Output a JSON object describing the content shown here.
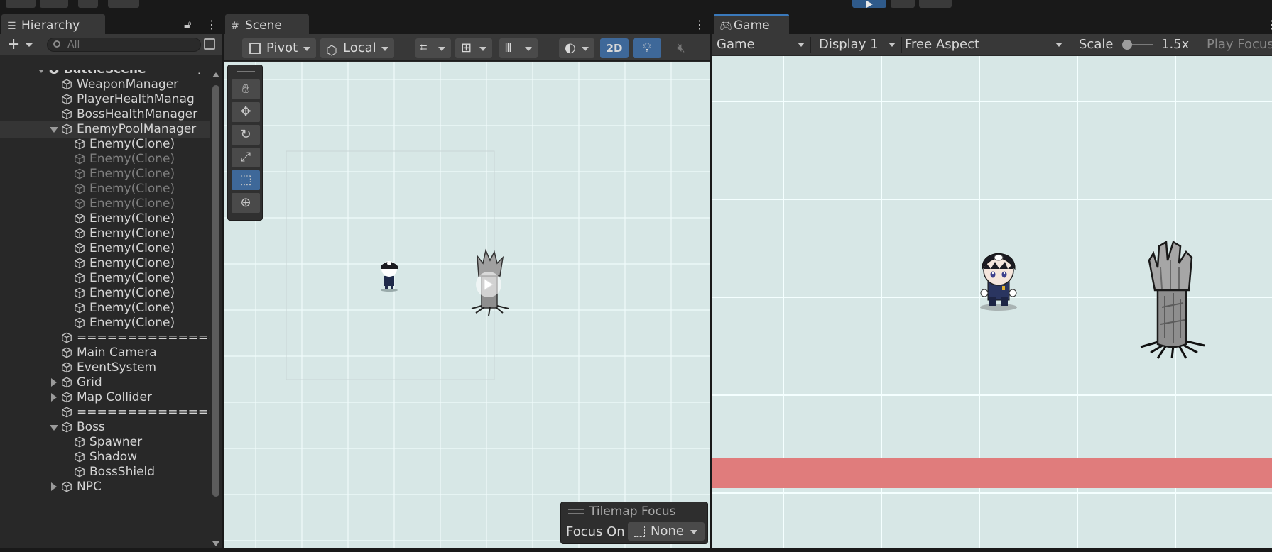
{
  "hierarchy": {
    "tab_label": "Hierarchy",
    "search_placeholder": "All",
    "rows": [
      {
        "label": "BattleScene",
        "indent": 0,
        "expander": "down",
        "icon": "unity-scene-icon",
        "bold": true,
        "dim": false
      },
      {
        "label": "WeaponManager",
        "indent": 1,
        "expander": "none",
        "icon": "gameobject-cube-icon",
        "bold": false,
        "dim": false
      },
      {
        "label": "PlayerHealthManag",
        "indent": 1,
        "expander": "none",
        "icon": "gameobject-cube-icon",
        "bold": false,
        "dim": false
      },
      {
        "label": "BossHealthManager",
        "indent": 1,
        "expander": "none",
        "icon": "gameobject-cube-icon",
        "bold": false,
        "dim": false
      },
      {
        "label": "EnemyPoolManager",
        "indent": 1,
        "expander": "down",
        "icon": "gameobject-cube-icon",
        "bold": false,
        "dim": false,
        "selected": true
      },
      {
        "label": "Enemy(Clone)",
        "indent": 2,
        "expander": "none",
        "icon": "gameobject-cube-icon",
        "bold": false,
        "dim": false
      },
      {
        "label": "Enemy(Clone)",
        "indent": 2,
        "expander": "none",
        "icon": "gameobject-cube-icon",
        "bold": false,
        "dim": true
      },
      {
        "label": "Enemy(Clone)",
        "indent": 2,
        "expander": "none",
        "icon": "gameobject-cube-icon",
        "bold": false,
        "dim": true
      },
      {
        "label": "Enemy(Clone)",
        "indent": 2,
        "expander": "none",
        "icon": "gameobject-cube-icon",
        "bold": false,
        "dim": true
      },
      {
        "label": "Enemy(Clone)",
        "indent": 2,
        "expander": "none",
        "icon": "gameobject-cube-icon",
        "bold": false,
        "dim": true
      },
      {
        "label": "Enemy(Clone)",
        "indent": 2,
        "expander": "none",
        "icon": "gameobject-cube-icon",
        "bold": false,
        "dim": false
      },
      {
        "label": "Enemy(Clone)",
        "indent": 2,
        "expander": "none",
        "icon": "gameobject-cube-icon",
        "bold": false,
        "dim": false
      },
      {
        "label": "Enemy(Clone)",
        "indent": 2,
        "expander": "none",
        "icon": "gameobject-cube-icon",
        "bold": false,
        "dim": false
      },
      {
        "label": "Enemy(Clone)",
        "indent": 2,
        "expander": "none",
        "icon": "gameobject-cube-icon",
        "bold": false,
        "dim": false
      },
      {
        "label": "Enemy(Clone)",
        "indent": 2,
        "expander": "none",
        "icon": "gameobject-cube-icon",
        "bold": false,
        "dim": false
      },
      {
        "label": "Enemy(Clone)",
        "indent": 2,
        "expander": "none",
        "icon": "gameobject-cube-icon",
        "bold": false,
        "dim": false
      },
      {
        "label": "Enemy(Clone)",
        "indent": 2,
        "expander": "none",
        "icon": "gameobject-cube-icon",
        "bold": false,
        "dim": false
      },
      {
        "label": "Enemy(Clone)",
        "indent": 2,
        "expander": "none",
        "icon": "gameobject-cube-icon",
        "bold": false,
        "dim": false
      },
      {
        "label": "==============",
        "indent": 1,
        "expander": "none",
        "icon": "gameobject-cube-icon",
        "bold": false,
        "dim": false
      },
      {
        "label": "Main Camera",
        "indent": 1,
        "expander": "none",
        "icon": "gameobject-cube-icon",
        "bold": false,
        "dim": false
      },
      {
        "label": "EventSystem",
        "indent": 1,
        "expander": "none",
        "icon": "gameobject-cube-icon",
        "bold": false,
        "dim": false
      },
      {
        "label": "Grid",
        "indent": 1,
        "expander": "right",
        "icon": "gameobject-cube-icon",
        "bold": false,
        "dim": false
      },
      {
        "label": "Map Collider",
        "indent": 1,
        "expander": "right",
        "icon": "gameobject-cube-icon",
        "bold": false,
        "dim": false
      },
      {
        "label": "==============",
        "indent": 1,
        "expander": "none",
        "icon": "gameobject-cube-icon",
        "bold": false,
        "dim": false
      },
      {
        "label": "Boss",
        "indent": 1,
        "expander": "down",
        "icon": "gameobject-cube-icon",
        "bold": false,
        "dim": false
      },
      {
        "label": "Spawner",
        "indent": 2,
        "expander": "none",
        "icon": "gameobject-cube-icon",
        "bold": false,
        "dim": false
      },
      {
        "label": "Shadow",
        "indent": 2,
        "expander": "none",
        "icon": "gameobject-cube-icon",
        "bold": false,
        "dim": false
      },
      {
        "label": "BossShield",
        "indent": 2,
        "expander": "none",
        "icon": "gameobject-cube-icon",
        "bold": false,
        "dim": false
      },
      {
        "label": "NPC",
        "indent": 1,
        "expander": "right",
        "icon": "gameobject-cube-icon",
        "bold": false,
        "dim": false
      }
    ]
  },
  "scene": {
    "tab_label": "Scene",
    "pivot_label": "Pivot",
    "local_label": "Local",
    "mode_2d_label": "2D",
    "tools": [
      "hand-tool-icon",
      "move-tool-icon",
      "rotate-tool-icon",
      "scale-tool-icon",
      "rect-tool-icon",
      "transform-tool-icon"
    ],
    "active_tool_index": 4,
    "tilemap_focus": {
      "title": "Tilemap Focus",
      "focus_on_label": "Focus On",
      "value": "None"
    }
  },
  "game": {
    "tab_label": "Game",
    "mode_select": "Game",
    "display_select": "Display 1",
    "aspect_select": "Free Aspect",
    "scale_label": "Scale",
    "scale_value": "1.5x",
    "scale_slider_fraction": 0.1,
    "play_focus_label": "Play Focus"
  },
  "colors": {
    "accent_blue": "#3e6899",
    "viewport_bg": "#d7e7e6",
    "grid_line": "#f4ffff",
    "health_bar": "#e07c7c"
  }
}
